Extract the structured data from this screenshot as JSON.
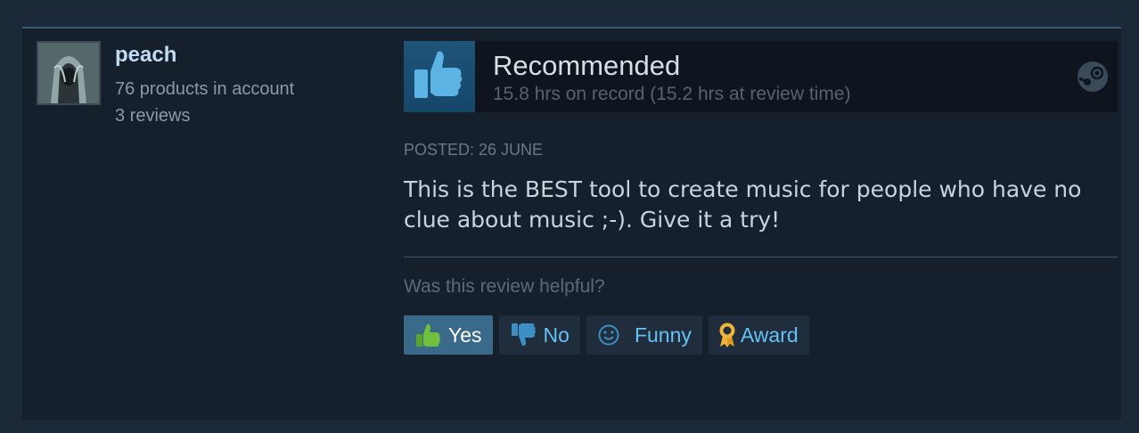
{
  "author": {
    "name": "peach",
    "products": "76 products in account",
    "reviews": "3 reviews"
  },
  "verdict": {
    "title": "Recommended",
    "hours": "15.8 hrs on record (15.2 hrs at review time)",
    "icon": "thumbs-up-icon"
  },
  "review": {
    "posted": "Posted: 26 June",
    "text": "This is the BEST tool to create music for people who have no clue about music ;-). Give it a try!"
  },
  "helpful": {
    "question": "Was this review helpful?",
    "buttons": [
      {
        "label": "Yes",
        "icon": "thumbs-up-icon",
        "active": true
      },
      {
        "label": "No",
        "icon": "thumbs-down-icon",
        "active": false
      },
      {
        "label": "Funny",
        "icon": "smiley-icon",
        "active": false
      },
      {
        "label": "Award",
        "icon": "award-ribbon-icon",
        "active": false
      }
    ]
  },
  "colors": {
    "page_bg": "#1b2838",
    "card_bg": "#16202d",
    "accent_link": "#67c1f5",
    "active_button": "#3a6a8a",
    "thumb_green": "#5ba32b"
  }
}
